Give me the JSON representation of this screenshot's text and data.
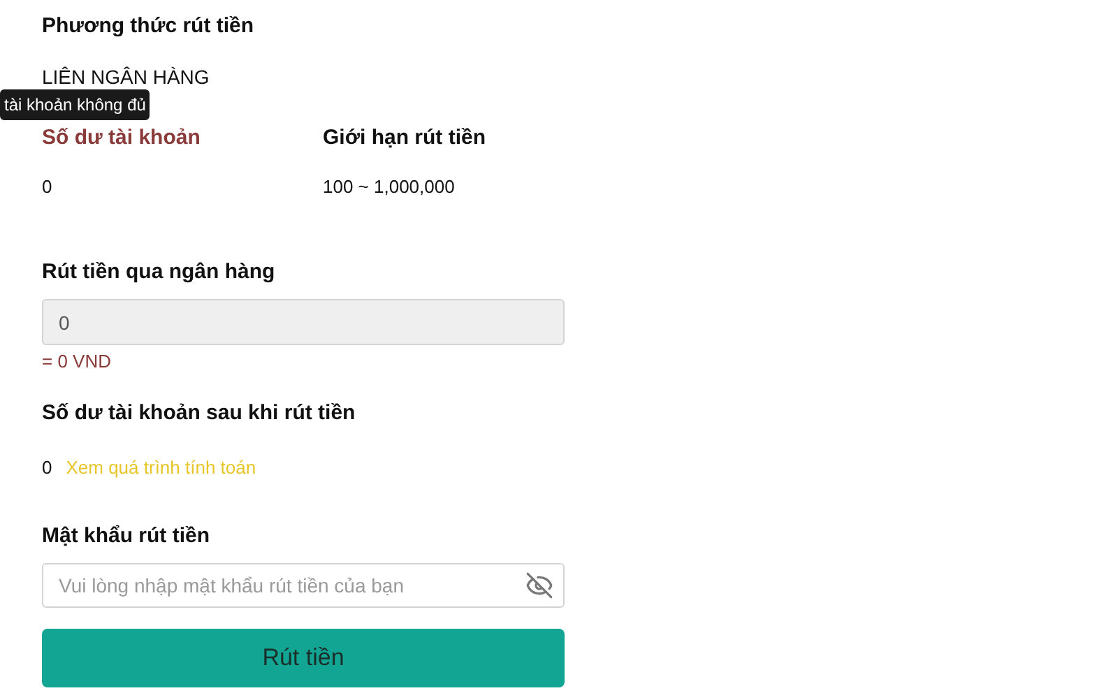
{
  "method": {
    "label": "Phương thức rút tiền",
    "value": "LIÊN NGÂN HÀNG"
  },
  "tooltip": {
    "text": "tài khoản không đủ"
  },
  "stats": [
    {
      "label": "Số dư tài khoản",
      "value": "0",
      "warning": true
    },
    {
      "label": "Giới hạn rút tiền",
      "value": "100 ~ 1,000,000",
      "warning": false
    }
  ],
  "bank_withdraw": {
    "label": "Rút tiền qua ngân hàng",
    "value": "0",
    "disabled": true,
    "conversion": "= 0 VND"
  },
  "balance_after": {
    "label": "Số dư tài khoản sau khi rút tiền",
    "value": "0",
    "link": "Xem quá trình tính toán"
  },
  "password": {
    "label": "Mật khẩu rút tiền",
    "placeholder": "Vui lòng nhập mật khẩu rút tiền của bạn",
    "visible": false
  },
  "submit": {
    "label": "Rút tiền"
  }
}
